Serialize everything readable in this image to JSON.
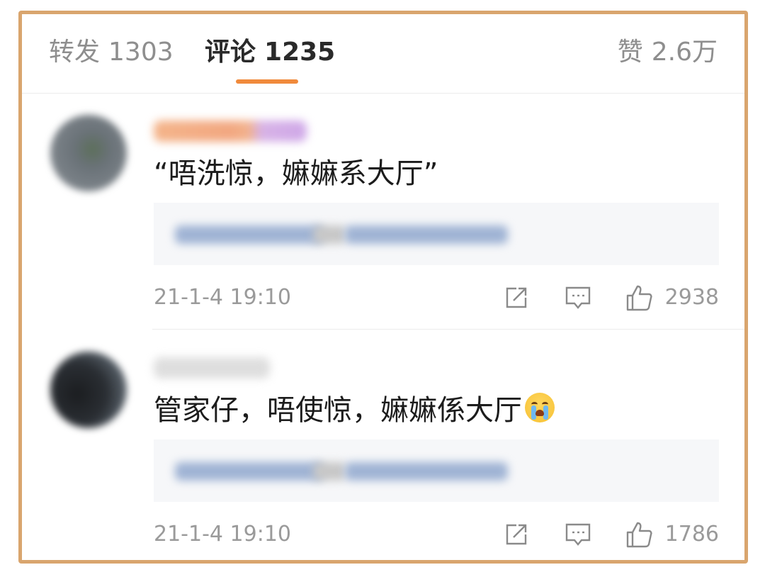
{
  "tabs": {
    "repost": {
      "label": "转发",
      "count": "1303"
    },
    "comments": {
      "label": "评论",
      "count": "1235",
      "active": true
    },
    "likes": {
      "label": "赞",
      "count": "2.6万"
    }
  },
  "accent_color": "#f08a3c",
  "frame_color": "#d9a56e",
  "comments": [
    {
      "text": "“唔洗惊，嫲嫲系大厅”",
      "timestamp": "21-1-4 19:10",
      "like_count": "2938",
      "icons": [
        "share-icon",
        "comment-icon",
        "thumbs-up-icon"
      ]
    },
    {
      "text": "管家仔，唔使惊，嫲嫲係大厅",
      "emoji": "crying-face-emoji",
      "timestamp": "21-1-4 19:10",
      "like_count": "1786",
      "icons": [
        "share-icon",
        "comment-icon",
        "thumbs-up-icon"
      ]
    }
  ]
}
